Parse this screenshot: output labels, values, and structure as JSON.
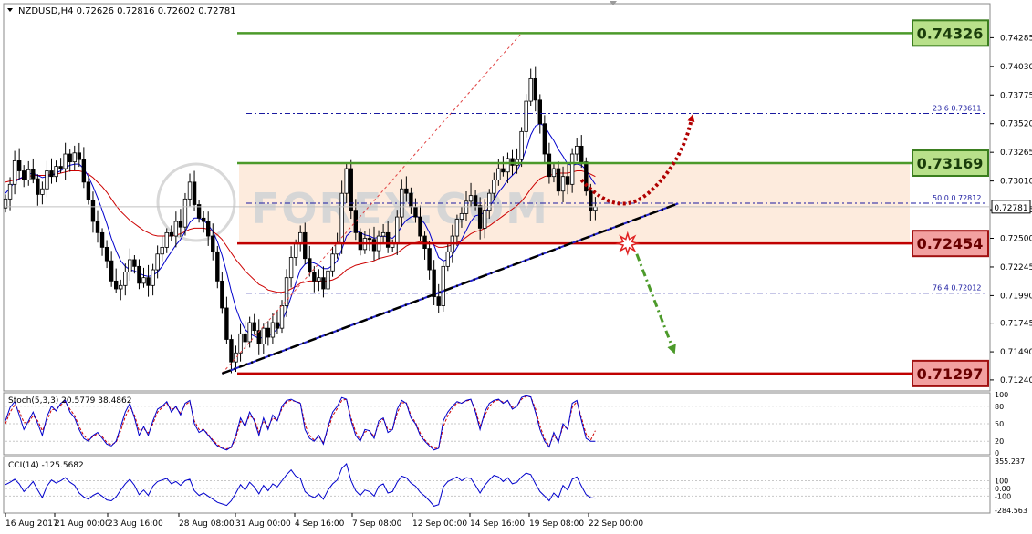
{
  "header": {
    "symbol_line": "NZDUSD,H4  0.72626 0.72816 0.72602 0.72781"
  },
  "watermark": "FOREX.COM",
  "colors": {
    "bull_candle": "#ffffff",
    "bear_candle": "#000000",
    "ma_fast": "#0000cc",
    "ma_slow": "#cc0000",
    "support_line": "#c00000",
    "resistance_line": "#4c9a2a",
    "zone_fill": "#fde9d9",
    "label_green_bg": "#b8e08a",
    "label_red_bg": "#f2a0a0",
    "stoch_main": "#0000cc",
    "stoch_signal": "#cc0000",
    "cci_line": "#0000cc"
  },
  "chart_data": {
    "type": "candlestick",
    "symbol": "NZDUSD",
    "timeframe": "H4",
    "ohlc_current": {
      "open": 0.72626,
      "high": 0.72816,
      "low": 0.72602,
      "close": 0.72781
    },
    "current_price_label": "0.72781",
    "ylim": [
      0.7115,
      0.7458
    ],
    "price_ticks": [
      "0.74285",
      "0.74030",
      "0.73775",
      "0.73520",
      "0.73265",
      "0.73010",
      "0.72755",
      "0.72500",
      "0.72245",
      "0.71990",
      "0.71745",
      "0.71490",
      "0.71240"
    ],
    "x_ticks": [
      "16 Aug 2017",
      "21 Aug 00:00",
      "23 Aug 16:00",
      "28 Aug 08:00",
      "31 Aug 00:00",
      "4 Sep 16:00",
      "7 Sep 08:00",
      "12 Sep 00:00",
      "14 Sep 16:00",
      "19 Sep 08:00",
      "22 Sep 00:00"
    ],
    "closes": [
      0.7285,
      0.7298,
      0.7319,
      0.731,
      0.7302,
      0.7311,
      0.7303,
      0.7289,
      0.7294,
      0.731,
      0.7305,
      0.7314,
      0.7312,
      0.7325,
      0.7318,
      0.7326,
      0.732,
      0.73,
      0.7284,
      0.7265,
      0.7255,
      0.7242,
      0.723,
      0.7212,
      0.7205,
      0.7208,
      0.722,
      0.7231,
      0.7225,
      0.721,
      0.7215,
      0.7208,
      0.7222,
      0.7236,
      0.7242,
      0.7255,
      0.7252,
      0.7265,
      0.726,
      0.7285,
      0.73,
      0.728,
      0.7268,
      0.7265,
      0.7252,
      0.7238,
      0.7212,
      0.7188,
      0.716,
      0.714,
      0.7148,
      0.7165,
      0.7158,
      0.7175,
      0.7168,
      0.7156,
      0.717,
      0.7162,
      0.7175,
      0.717,
      0.719,
      0.7215,
      0.7233,
      0.7245,
      0.7255,
      0.7232,
      0.722,
      0.7212,
      0.7215,
      0.7205,
      0.7221,
      0.7236,
      0.7246,
      0.729,
      0.7312,
      0.7275,
      0.7255,
      0.724,
      0.725,
      0.7249,
      0.7239,
      0.7252,
      0.7255,
      0.7242,
      0.7245,
      0.7269,
      0.7294,
      0.729,
      0.7278,
      0.7269,
      0.7252,
      0.7241,
      0.7222,
      0.7198,
      0.719,
      0.7225,
      0.7238,
      0.7252,
      0.7267,
      0.7272,
      0.7283,
      0.7288,
      0.7279,
      0.7259,
      0.7275,
      0.729,
      0.7302,
      0.7312,
      0.7309,
      0.7321,
      0.7315,
      0.732,
      0.7345,
      0.7372,
      0.7392,
      0.7373,
      0.7352,
      0.7325,
      0.7305,
      0.7312,
      0.7292,
      0.7305,
      0.7298,
      0.7325,
      0.7332,
      0.7318,
      0.7292,
      0.7275,
      0.7278
    ],
    "ma_fast_values": [
      0.729,
      0.7295,
      0.73,
      0.7303,
      0.7305,
      0.7307,
      0.7308,
      0.7306,
      0.7304,
      0.7305,
      0.7306,
      0.7308,
      0.731,
      0.7313,
      0.7315,
      0.7316,
      0.7316,
      0.7312,
      0.7305,
      0.7296,
      0.7286,
      0.7275,
      0.7263,
      0.725,
      0.7239,
      0.723,
      0.7225,
      0.7222,
      0.7221,
      0.7219,
      0.7217,
      0.7216,
      0.7217,
      0.722,
      0.7225,
      0.7232,
      0.7238,
      0.7244,
      0.7249,
      0.7256,
      0.7264,
      0.7268,
      0.7268,
      0.7266,
      0.7262,
      0.7256,
      0.7247,
      0.7235,
      0.722,
      0.7203,
      0.7188,
      0.7177,
      0.7169,
      0.7165,
      0.7163,
      0.7161,
      0.7162,
      0.7163,
      0.7166,
      0.7169,
      0.7176,
      0.7186,
      0.7198,
      0.721,
      0.7222,
      0.7227,
      0.7229,
      0.7228,
      0.7226,
      0.7223,
      0.7223,
      0.7226,
      0.723,
      0.724,
      0.7252,
      0.7256,
      0.7257,
      0.7255,
      0.7253,
      0.7252,
      0.725,
      0.7251,
      0.7252,
      0.7251,
      0.725,
      0.7254,
      0.7261,
      0.7266,
      0.7269,
      0.727,
      0.7268,
      0.7263,
      0.7255,
      0.7244,
      0.7233,
      0.723,
      0.7231,
      0.7235,
      0.7242,
      0.7249,
      0.7257,
      0.7265,
      0.727,
      0.7271,
      0.7273,
      0.7278,
      0.7284,
      0.7291,
      0.7296,
      0.7302,
      0.7306,
      0.731,
      0.7318,
      0.7329,
      0.7342,
      0.735,
      0.7352,
      0.735,
      0.7343,
      0.7337,
      0.7329,
      0.7323,
      0.7316,
      0.7315,
      0.7316,
      0.7315,
      0.7311,
      0.7304,
      0.7298
    ],
    "ma_slow_values": [
      0.73,
      0.7301,
      0.7302,
      0.7303,
      0.7304,
      0.7305,
      0.7306,
      0.7306,
      0.7306,
      0.7306,
      0.7307,
      0.7307,
      0.7308,
      0.7309,
      0.731,
      0.731,
      0.731,
      0.7309,
      0.7307,
      0.7304,
      0.73,
      0.7296,
      0.7291,
      0.7285,
      0.7279,
      0.7274,
      0.727,
      0.7266,
      0.7263,
      0.726,
      0.7257,
      0.7255,
      0.7253,
      0.7252,
      0.7252,
      0.7252,
      0.7252,
      0.7253,
      0.7254,
      0.7256,
      0.7258,
      0.7259,
      0.7259,
      0.7259,
      0.7258,
      0.7256,
      0.7253,
      0.7249,
      0.7243,
      0.7237,
      0.7231,
      0.7226,
      0.7221,
      0.7217,
      0.7213,
      0.7209,
      0.7207,
      0.7204,
      0.7203,
      0.7202,
      0.7202,
      0.7203,
      0.7205,
      0.7207,
      0.721,
      0.7211,
      0.7212,
      0.7212,
      0.7212,
      0.7212,
      0.7212,
      0.7213,
      0.7215,
      0.7218,
      0.7222,
      0.7224,
      0.7226,
      0.7227,
      0.7228,
      0.7229,
      0.723,
      0.7232,
      0.7233,
      0.7234,
      0.7235,
      0.7237,
      0.724,
      0.7243,
      0.7245,
      0.7246,
      0.7247,
      0.7247,
      0.7246,
      0.7244,
      0.7242,
      0.7242,
      0.7243,
      0.7244,
      0.7246,
      0.7248,
      0.7251,
      0.7254,
      0.7256,
      0.7257,
      0.7259,
      0.7261,
      0.7264,
      0.7267,
      0.727,
      0.7273,
      0.7276,
      0.7279,
      0.7283,
      0.7288,
      0.7294,
      0.7299,
      0.7303,
      0.7305,
      0.7306,
      0.7307,
      0.7308,
      0.7308,
      0.7308,
      0.7309,
      0.731,
      0.731,
      0.7309,
      0.7307,
      0.7305
    ],
    "levels": [
      {
        "name": "resistance-top",
        "value": 0.74326,
        "label": "0.74326",
        "kind": "resistance"
      },
      {
        "name": "resistance-mid",
        "value": 0.73169,
        "label": "0.73169",
        "kind": "resistance"
      },
      {
        "name": "support-mid",
        "value": 0.72454,
        "label": "0.72454",
        "kind": "support"
      },
      {
        "name": "support-low",
        "value": 0.71297,
        "label": "0.71297",
        "kind": "support"
      }
    ],
    "fibonacci": [
      {
        "ratio": "23.6",
        "price": "0.73611",
        "value": 0.73611
      },
      {
        "ratio": "50.0",
        "price": "0.72812",
        "value": 0.72812
      },
      {
        "ratio": "76.4",
        "price": "0.72012",
        "value": 0.72012
      }
    ],
    "zone": {
      "from": 0.72454,
      "to": 0.73169
    },
    "trendline": {
      "from_index": 47,
      "from_value": 0.71297,
      "to_index": 146,
      "to_value": 0.7281
    },
    "fib_anchor": {
      "from_index": 47,
      "from_value": 0.71297,
      "to_index": 112,
      "to_value": 0.74326
    },
    "breakout_marker": {
      "index": 135,
      "value": 0.72454
    },
    "projections": [
      {
        "name": "bullish-path",
        "points": [
          [
            125,
            0.7302
          ],
          [
            133,
            0.728
          ],
          [
            140,
            0.7292
          ],
          [
            149,
            0.7358
          ]
        ]
      },
      {
        "name": "bearish-path",
        "points": [
          [
            137,
            0.7236
          ],
          [
            145,
            0.715
          ]
        ]
      }
    ],
    "stochastic": {
      "label": "Stoch(5,3,3) 20.5779 38.4862",
      "levels": [
        "100",
        "80",
        "50",
        "20",
        "0"
      ],
      "main": [
        55,
        78,
        88,
        65,
        40,
        55,
        70,
        50,
        30,
        62,
        80,
        72,
        85,
        90,
        70,
        60,
        40,
        25,
        20,
        30,
        35,
        25,
        15,
        12,
        20,
        45,
        70,
        85,
        60,
        30,
        45,
        30,
        55,
        75,
        80,
        88,
        70,
        80,
        65,
        85,
        90,
        50,
        35,
        40,
        30,
        20,
        12,
        8,
        5,
        10,
        30,
        60,
        45,
        70,
        55,
        30,
        60,
        40,
        65,
        55,
        80,
        90,
        92,
        88,
        85,
        40,
        25,
        20,
        30,
        15,
        45,
        70,
        80,
        95,
        92,
        55,
        30,
        20,
        40,
        38,
        25,
        55,
        60,
        35,
        40,
        75,
        90,
        85,
        60,
        50,
        30,
        20,
        12,
        5,
        8,
        55,
        70,
        80,
        88,
        85,
        90,
        92,
        70,
        40,
        70,
        85,
        90,
        92,
        85,
        90,
        75,
        80,
        95,
        98,
        96,
        70,
        40,
        20,
        10,
        35,
        18,
        50,
        40,
        85,
        90,
        55,
        25,
        20,
        20
      ],
      "signal": [
        50,
        70,
        82,
        72,
        52,
        52,
        64,
        55,
        38,
        55,
        74,
        75,
        82,
        88,
        75,
        64,
        45,
        30,
        22,
        28,
        33,
        28,
        18,
        14,
        18,
        38,
        62,
        78,
        65,
        38,
        42,
        34,
        50,
        70,
        78,
        85,
        74,
        78,
        68,
        82,
        88,
        55,
        40,
        40,
        32,
        22,
        14,
        10,
        7,
        9,
        26,
        54,
        48,
        64,
        58,
        36,
        55,
        44,
        60,
        56,
        76,
        88,
        90,
        88,
        86,
        48,
        30,
        22,
        28,
        18,
        40,
        64,
        76,
        90,
        92,
        60,
        36,
        22,
        36,
        38,
        28,
        50,
        58,
        40,
        40,
        68,
        86,
        86,
        64,
        52,
        34,
        22,
        14,
        8,
        8,
        45,
        64,
        76,
        86,
        86,
        89,
        91,
        74,
        46,
        64,
        80,
        88,
        91,
        87,
        89,
        78,
        80,
        92,
        97,
        96,
        76,
        46,
        24,
        12,
        30,
        20,
        45,
        42,
        78,
        88,
        60,
        32,
        22,
        38
      ]
    },
    "cci": {
      "label": "CCI(14) -125.5682",
      "levels": [
        "355.237",
        "100",
        "0.00",
        "-100",
        "-284.563"
      ],
      "values": [
        50,
        80,
        120,
        60,
        -40,
        20,
        90,
        -20,
        -120,
        30,
        110,
        70,
        100,
        140,
        80,
        40,
        -60,
        -110,
        -140,
        -90,
        -60,
        -100,
        -150,
        -160,
        -110,
        -20,
        60,
        120,
        40,
        -80,
        -20,
        -90,
        30,
        90,
        110,
        130,
        60,
        90,
        40,
        100,
        120,
        -30,
        -90,
        -60,
        -100,
        -140,
        -180,
        -200,
        -220,
        -160,
        -60,
        50,
        -20,
        80,
        20,
        -70,
        40,
        -30,
        60,
        20,
        100,
        180,
        240,
        160,
        130,
        -40,
        -90,
        -120,
        -70,
        -140,
        -20,
        60,
        110,
        260,
        320,
        100,
        -30,
        -90,
        -20,
        -40,
        -100,
        30,
        60,
        -60,
        -40,
        80,
        160,
        140,
        70,
        30,
        -50,
        -100,
        -160,
        -230,
        -210,
        20,
        90,
        120,
        150,
        100,
        140,
        130,
        40,
        -60,
        40,
        110,
        170,
        150,
        90,
        140,
        60,
        80,
        150,
        200,
        180,
        60,
        -40,
        -100,
        -160,
        -60,
        -120,
        40,
        -20,
        120,
        150,
        30,
        -80,
        -120,
        -126
      ]
    }
  }
}
